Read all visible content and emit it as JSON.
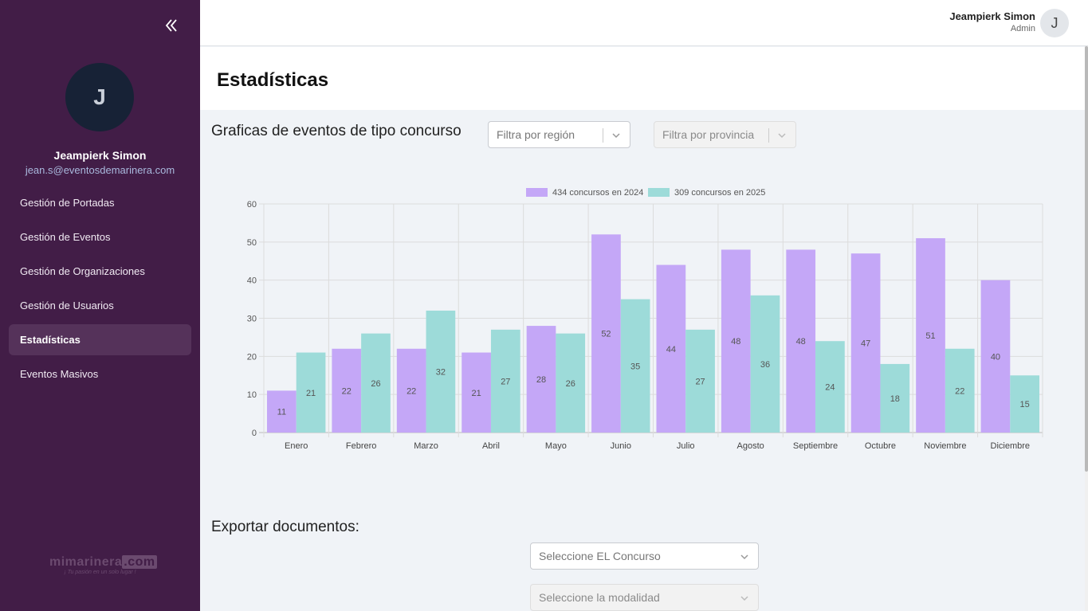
{
  "sidebar": {
    "avatar_initial": "J",
    "user_name": "Jeampierk Simon",
    "user_email": "jean.s@eventosdemarinera.com",
    "items": [
      {
        "label": "Gestión de Portadas"
      },
      {
        "label": "Gestión de Eventos"
      },
      {
        "label": "Gestión de Organizaciones"
      },
      {
        "label": "Gestión de Usuarios"
      },
      {
        "label": "Estadísticas"
      },
      {
        "label": "Eventos Masivos"
      }
    ],
    "active_item": "Estadísticas",
    "logo_main": "mimarinera",
    "logo_suffix": ".com",
    "logo_tagline": "¡ Tu pasión en un solo lugar !"
  },
  "header": {
    "user_name": "Jeampierk Simon",
    "user_role": "Admin",
    "avatar_initial": "J"
  },
  "page": {
    "title": "Estadísticas",
    "chart_section_title": "Graficas de eventos de tipo concurso",
    "filter_region_placeholder": "Filtra por región",
    "filter_province_placeholder": "Filtra por provincia",
    "export_title": "Exportar documentos:",
    "contest_select_placeholder": "Seleccione EL Concurso",
    "modality_select_placeholder": "Seleccione la modalidad"
  },
  "colors": {
    "sidebar_bg": "#421d47",
    "series_2024": "#c4a7f7",
    "series_2025": "#9ddbd9"
  },
  "chart_data": {
    "type": "bar",
    "categories": [
      "Enero",
      "Febrero",
      "Marzo",
      "Abril",
      "Mayo",
      "Junio",
      "Julio",
      "Agosto",
      "Septiembre",
      "Octubre",
      "Noviembre",
      "Diciembre"
    ],
    "series": [
      {
        "name": "434 concursos en 2024",
        "values": [
          11,
          22,
          22,
          21,
          28,
          52,
          44,
          48,
          48,
          47,
          51,
          40
        ],
        "color": "#c4a7f7"
      },
      {
        "name": "309 concursos en 2025",
        "values": [
          21,
          26,
          32,
          27,
          26,
          35,
          27,
          36,
          24,
          18,
          22,
          15
        ],
        "color": "#9ddbd9"
      }
    ],
    "ylim": [
      0,
      60
    ],
    "yticks": [
      0,
      10,
      20,
      30,
      40,
      50,
      60
    ],
    "legend": "top-center",
    "grid": true,
    "data_labels": true
  }
}
